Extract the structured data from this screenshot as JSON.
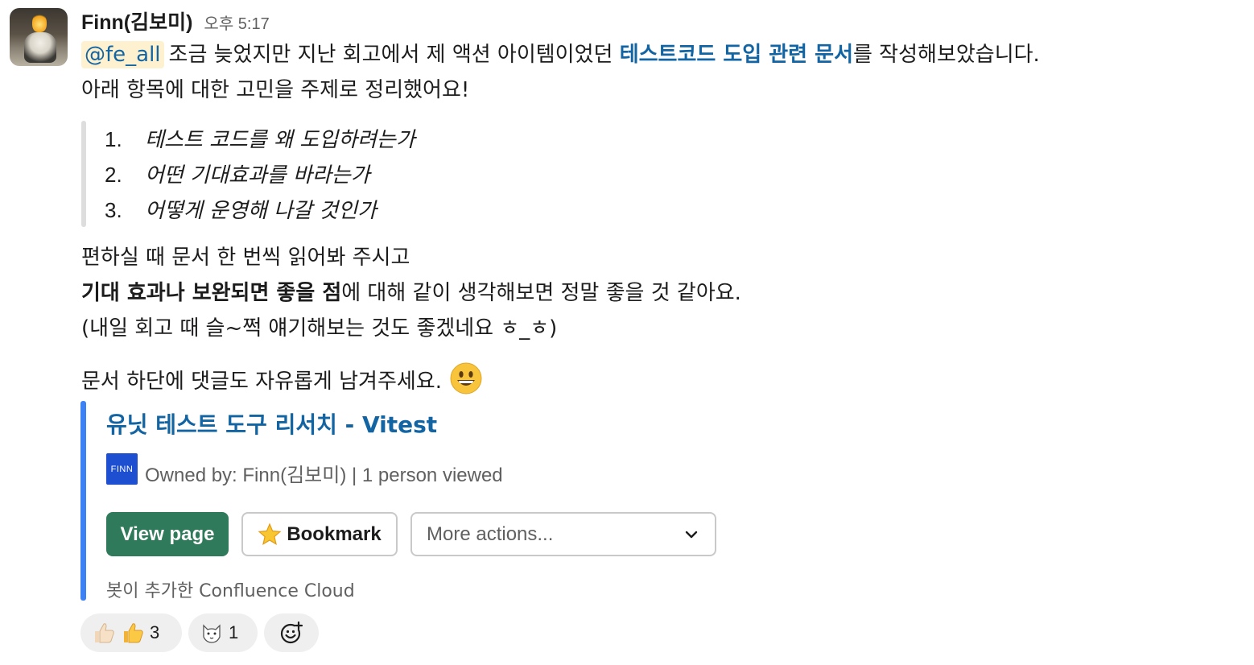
{
  "message": {
    "author": "Finn(김보미)",
    "time": "오후 5:17",
    "mention": "@fe_all",
    "line1_before": "조금 늦었지만 지난 회고에서 제 액션 아이템이었던 ",
    "line1_link": "테스트코드 도입 관련 문서",
    "line1_after": "를 작성해보았습니다.",
    "line2": "아래 항목에 대한 고민을 주제로 정리했어요!",
    "list": [
      {
        "num": "1.",
        "text": "테스트 코드를 왜 도입하려는가"
      },
      {
        "num": "2.",
        "text": "어떤 기대효과를 바라는가"
      },
      {
        "num": "3.",
        "text": "어떻게 운영해 나갈 것인가"
      }
    ],
    "line3": "편하실 때 문서 한 번씩 읽어봐 주시고",
    "line4_bold": "기대 효과나 보완되면 좋을 점",
    "line4_rest": "에 대해 같이 생각해보면 정말 좋을 것 같아요.",
    "line5": "(내일 회고 때 슬~쩍 얘기해보는 것도 좋겠네요 ㅎ_ㅎ)",
    "line6": "문서 하단에 댓글도 자유롭게 남겨주세요.",
    "line6_emoji": "grinning-face"
  },
  "card": {
    "title": "유닛 테스트 도구 리서치 - Vitest",
    "badge": "FINN",
    "meta": "Owned by: Finn(김보미) | 1 person viewed",
    "view_button": "View page",
    "bookmark_button": "Bookmark",
    "more_actions": "More actions...",
    "footer": "봇이 추가한 Confluence Cloud",
    "accent_color": "#3b82f6",
    "primary_color": "#2e7a5a"
  },
  "reactions": [
    {
      "icon": "thumbs-up-icon",
      "count": "3"
    },
    {
      "icon": "cat-face-icon",
      "count": "1"
    },
    {
      "icon": "add-reaction-icon",
      "count": ""
    }
  ]
}
